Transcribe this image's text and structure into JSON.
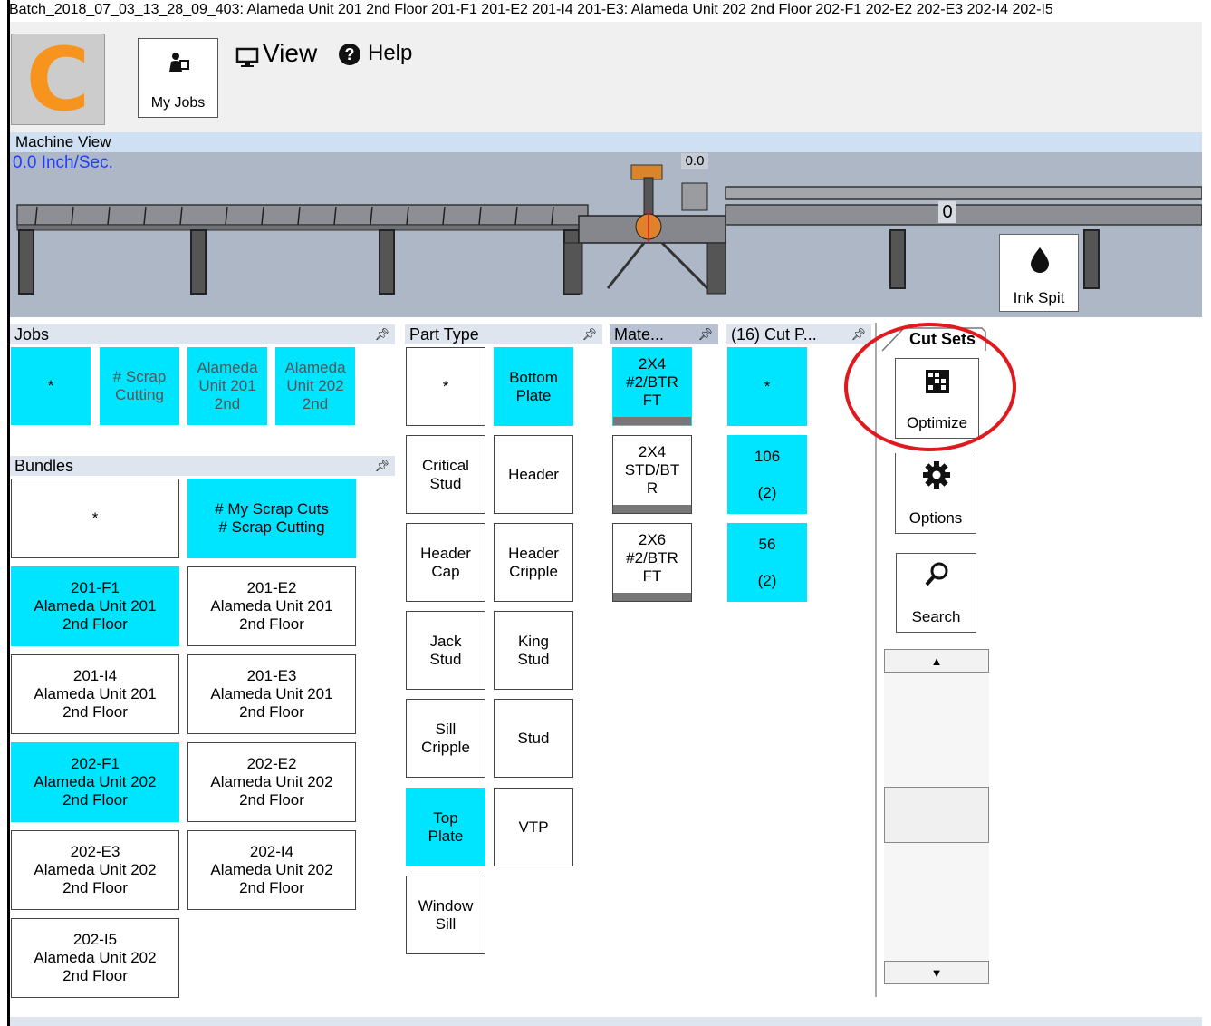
{
  "window_title": "Batch_2018_07_03_13_28_09_403: Alameda Unit 201 2nd Floor  201-F1 201-E2 201-I4 201-E3: Alameda Unit 202 2nd Floor  202-F1 202-E2 202-E3 202-I4 202-I5",
  "header": {
    "logo_letter": "C",
    "my_jobs_label": "My Jobs",
    "view_label": "View",
    "help_label": "Help"
  },
  "machine_view": {
    "title": "Machine View",
    "speed": "0.0 Inch/Sec.",
    "meter_value": "0.0",
    "position_value": "0",
    "ink_spit_label": "Ink Spit"
  },
  "jobs": {
    "title": "Jobs",
    "items": [
      {
        "label": "*",
        "selected": true
      },
      {
        "label": "# Scrap\nCutting",
        "selected": true
      },
      {
        "label": "Alameda\nUnit 201\n2nd",
        "selected": true
      },
      {
        "label": "Alameda\nUnit 202\n2nd",
        "selected": true
      }
    ]
  },
  "bundles": {
    "title": "Bundles",
    "items": [
      {
        "label": "*",
        "selected": false
      },
      {
        "label": "# My Scrap Cuts\n# Scrap Cutting",
        "selected": true
      },
      {
        "label": "201-F1\nAlameda Unit 201\n2nd Floor",
        "selected": true
      },
      {
        "label": "201-E2\nAlameda Unit 201\n2nd Floor",
        "selected": false
      },
      {
        "label": "201-I4\nAlameda Unit 201\n2nd Floor",
        "selected": false
      },
      {
        "label": "201-E3\nAlameda Unit 201\n2nd Floor",
        "selected": false
      },
      {
        "label": "202-F1\nAlameda Unit 202\n2nd Floor",
        "selected": true
      },
      {
        "label": "202-E2\nAlameda Unit 202\n2nd Floor",
        "selected": false
      },
      {
        "label": "202-E3\nAlameda Unit 202\n2nd Floor",
        "selected": false
      },
      {
        "label": "202-I4\nAlameda Unit 202\n2nd Floor",
        "selected": false
      },
      {
        "label": "202-I5\nAlameda Unit 202\n2nd Floor",
        "selected": false
      }
    ]
  },
  "part_type": {
    "title": "Part Type",
    "items": [
      {
        "label": "*",
        "selected": false
      },
      {
        "label": "Bottom\nPlate",
        "selected": true
      },
      {
        "label": "Critical\nStud",
        "selected": false
      },
      {
        "label": "Header",
        "selected": false
      },
      {
        "label": "Header\nCap",
        "selected": false
      },
      {
        "label": "Header\nCripple",
        "selected": false
      },
      {
        "label": "Jack\nStud",
        "selected": false
      },
      {
        "label": "King\nStud",
        "selected": false
      },
      {
        "label": "Sill\nCripple",
        "selected": false
      },
      {
        "label": "Stud",
        "selected": false
      },
      {
        "label": "Top\nPlate",
        "selected": true
      },
      {
        "label": "VTP",
        "selected": false
      },
      {
        "label": "Window\nSill",
        "selected": false
      }
    ]
  },
  "material": {
    "title": "Mate...",
    "items": [
      {
        "label": "2X4\n#2/BTR\nFT",
        "selected": true
      },
      {
        "label": "2X4\nSTD/BT\nR",
        "selected": false
      },
      {
        "label": "2X6\n#2/BTR\nFT",
        "selected": false
      }
    ]
  },
  "cut_parts": {
    "title": "(16) Cut P...",
    "items": [
      {
        "label": "*",
        "selected": true
      },
      {
        "label": "106\n\n(2)",
        "selected": true
      },
      {
        "label": "56\n\n(2)",
        "selected": true
      }
    ]
  },
  "cut_sets": {
    "tab_label": "Cut Sets",
    "optimize_label": "Optimize",
    "options_label": "Options",
    "search_label": "Search"
  },
  "colors": {
    "selected": "#00e5ff",
    "logo_orange": "#f7941d",
    "speed_blue": "#1e3fff",
    "highlight_red": "#e0191e"
  }
}
